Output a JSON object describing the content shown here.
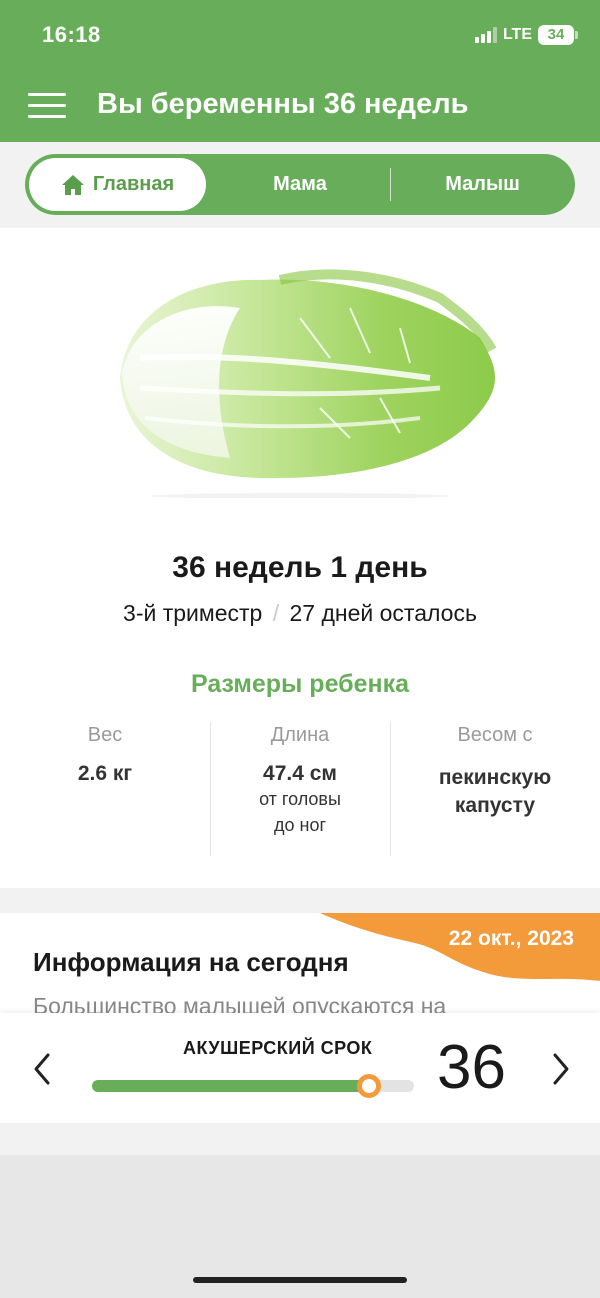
{
  "status_bar": {
    "time": "16:18",
    "network": "LTE",
    "battery": "34"
  },
  "header": {
    "title": "Вы беременны 36 недель",
    "menu_icon": "hamburger-menu-icon"
  },
  "tabs": [
    {
      "label": "Главная",
      "icon": "home-icon",
      "active": true
    },
    {
      "label": "Мама",
      "active": false
    },
    {
      "label": "Малыш",
      "active": false
    }
  ],
  "pregnancy": {
    "week_day": "36 недель 1 день",
    "trimester": "3-й триместр",
    "separator": "/",
    "days_left": "27 дней осталось"
  },
  "baby_size": {
    "title": "Размеры ребенка",
    "weight_label": "Вес",
    "weight_value": "2.6 кг",
    "length_label": "Длина",
    "length_value": "47.4 см",
    "length_note_1": "от головы",
    "length_note_2": "до ног",
    "compare_label": "Весом с",
    "compare_value_1": "пекинскую",
    "compare_value_2": "капусту",
    "compare_image": "napa-cabbage"
  },
  "info": {
    "date": "22 окт., 2023",
    "title": "Информация на сегодня",
    "text": "Большинство малышей опускаются на"
  },
  "week_picker": {
    "label": "АКУШЕРСКИЙ СРОК",
    "week": "36",
    "progress": 0.86
  },
  "colors": {
    "brand_green": "#68ae5a",
    "accent_orange": "#f39a3a"
  }
}
